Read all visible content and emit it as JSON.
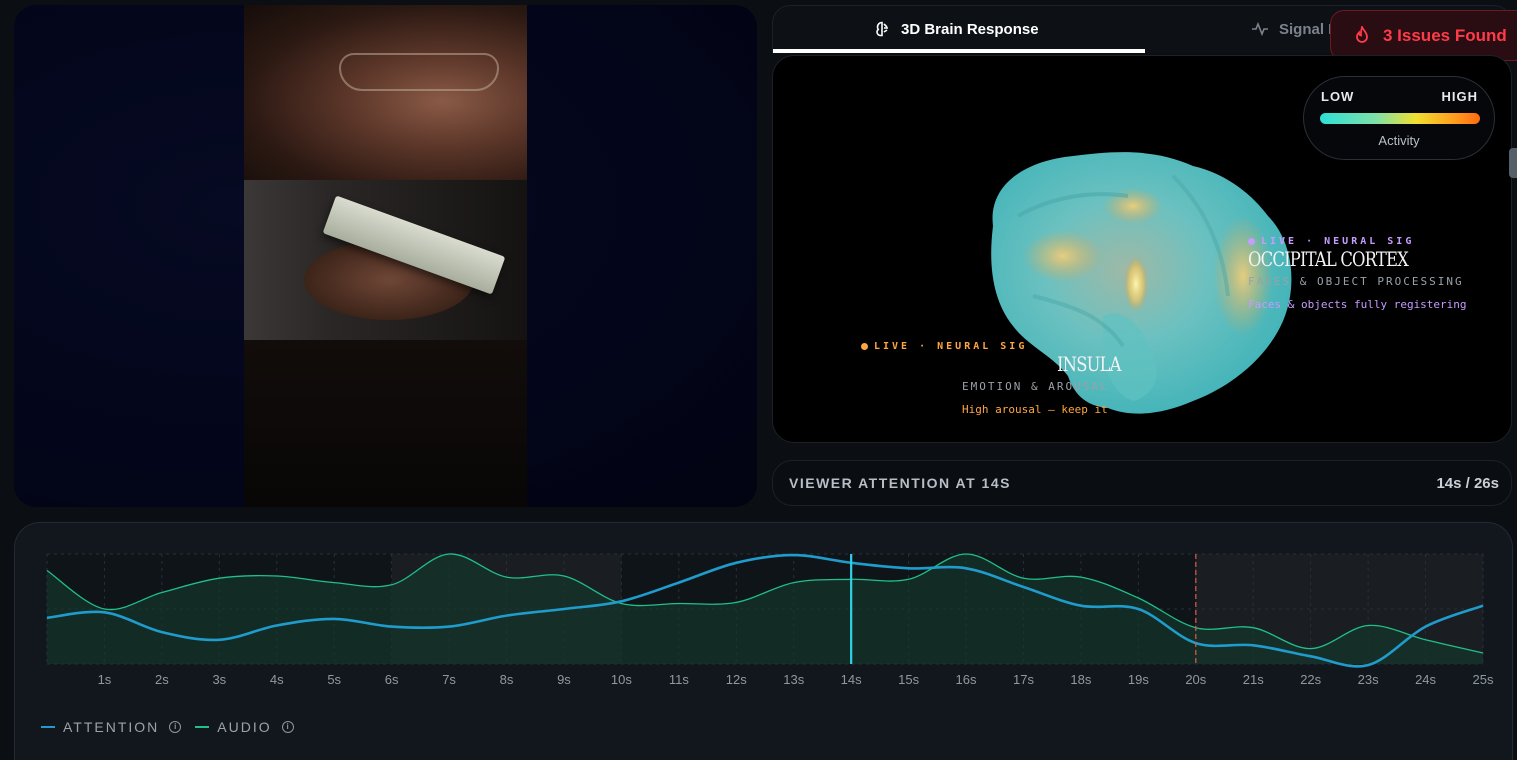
{
  "tabs": {
    "brain_label": "3D Brain Response",
    "signal_label": "Signal R"
  },
  "issues": {
    "label": "3 Issues Found",
    "color": "#ff3b49"
  },
  "legend": {
    "low": "LOW",
    "high": "HIGH",
    "label": "Activity"
  },
  "regions": {
    "occipital": {
      "live": "LIVE · NEURAL SIG",
      "name": "OCCIPITAL CORTEX",
      "function": "FACES & OBJECT PROCESSING",
      "note": "Faces & objects fully registering",
      "color": "#c69cff"
    },
    "insula": {
      "live": "LIVE · NEURAL SIG",
      "name": "INSULA",
      "function": "EMOTION & AROUSAL",
      "note": "High arousal — keep it",
      "color": "#ffa640"
    }
  },
  "attention_bar": {
    "title": "VIEWER ATTENTION AT 14S",
    "time": "14s / 26s"
  },
  "timeline": {
    "ticks": [
      "1s",
      "2s",
      "3s",
      "4s",
      "5s",
      "6s",
      "7s",
      "8s",
      "9s",
      "10s",
      "11s",
      "12s",
      "13s",
      "14s",
      "15s",
      "16s",
      "17s",
      "18s",
      "19s",
      "20s",
      "21s",
      "22s",
      "23s",
      "24s",
      "25s"
    ],
    "legend_attention": "ATTENTION",
    "legend_audio": "AUDIO",
    "attention_color": "#1f9ccc",
    "audio_color": "#1fc08a",
    "playhead_color": "#2fd0e8",
    "marker_color": "#e05a4a"
  },
  "chart_data": {
    "type": "line",
    "x": [
      0,
      1,
      2,
      3,
      4,
      5,
      6,
      7,
      8,
      9,
      10,
      11,
      12,
      13,
      14,
      15,
      16,
      17,
      18,
      19,
      20,
      21,
      22,
      23,
      24,
      25
    ],
    "series": [
      {
        "name": "ATTENTION",
        "values": [
          42,
          47,
          29,
          22,
          35,
          41,
          34,
          34,
          44,
          50,
          57,
          74,
          92,
          99,
          92,
          87,
          87,
          70,
          53,
          50,
          19,
          17,
          7,
          -1,
          34,
          53
        ]
      },
      {
        "name": "AUDIO",
        "values": [
          85,
          50,
          65,
          78,
          80,
          74,
          72,
          100,
          79,
          80,
          55,
          55,
          56,
          74,
          77,
          77,
          100,
          78,
          79,
          60,
          33,
          33,
          14,
          35,
          22,
          10
        ]
      }
    ],
    "ylim": [
      0,
      100
    ],
    "playhead": 14,
    "marker": 20,
    "highlight_ranges": [
      [
        6,
        10
      ],
      [
        20,
        25
      ]
    ]
  }
}
